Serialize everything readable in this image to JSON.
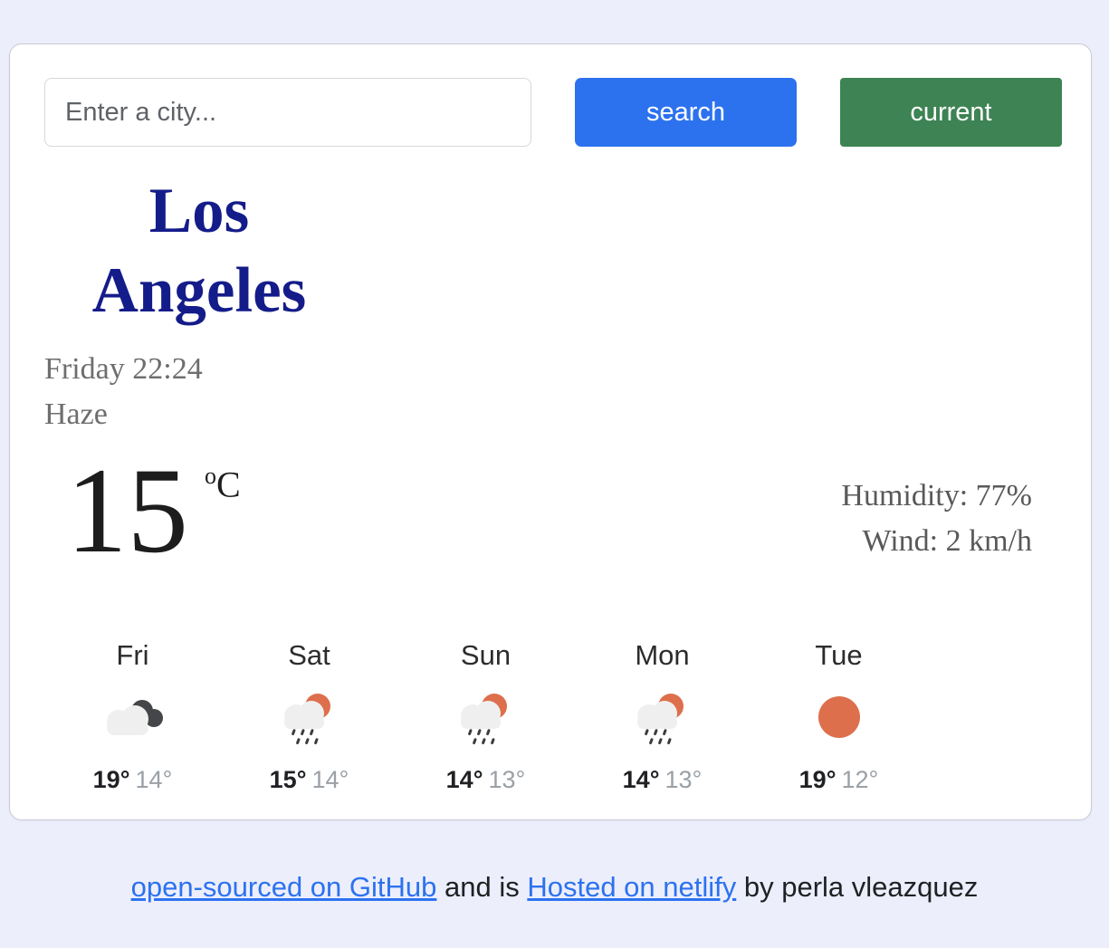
{
  "search": {
    "placeholder": "Enter a city...",
    "value": "",
    "search_label": "search",
    "current_label": "current"
  },
  "colors": {
    "page_background": "#eceefc",
    "card_background": "#ffffff",
    "search_button": "#2c72ef",
    "current_button": "#3e8354",
    "city_name": "#141c8a",
    "sun": "#dd6f4c",
    "cloud_light": "#f0f0f0",
    "cloud_dark": "#45464a",
    "link": "#2c72ef"
  },
  "current": {
    "city": "Los Angeles",
    "datetime": "Friday 22:24",
    "description": "Haze",
    "temperature": "15",
    "unit_degree": "o",
    "unit_letter": "C",
    "humidity": "Humidity: 77%",
    "wind": "Wind: 2 km/h",
    "icon": "haze-cloud-icon"
  },
  "forecast": [
    {
      "day": "Fri",
      "icon": "overcast-clouds-icon",
      "high": "19°",
      "low": "14°"
    },
    {
      "day": "Sat",
      "icon": "sun-cloud-rain-icon",
      "high": "15°",
      "low": "14°"
    },
    {
      "day": "Sun",
      "icon": "sun-cloud-rain-icon",
      "high": "14°",
      "low": "13°"
    },
    {
      "day": "Mon",
      "icon": "sun-cloud-rain-icon",
      "high": "14°",
      "low": "13°"
    },
    {
      "day": "Tue",
      "icon": "sun-icon",
      "high": "19°",
      "low": "12°"
    }
  ],
  "footer": {
    "github_link": "open-sourced on GitHub",
    "middle_text": " and is ",
    "netlify_link": "Hosted on netlify",
    "author_text": " by perla vleazquez"
  }
}
